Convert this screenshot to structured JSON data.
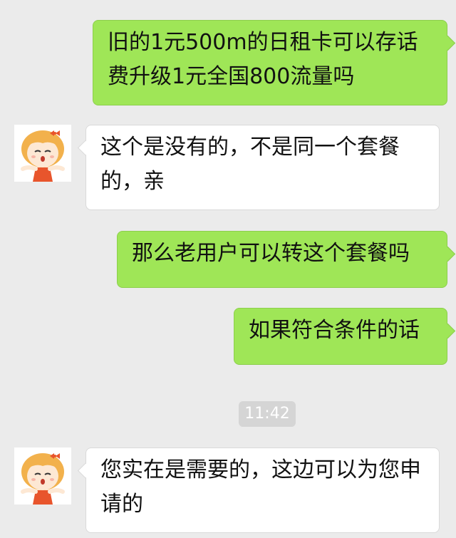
{
  "messages": [
    {
      "side": "sent",
      "text": "旧的1元500m的日租卡可以存话费升级1元全国800流量吗"
    },
    {
      "side": "recv",
      "text": "这个是没有的，不是同一个套餐的，亲"
    },
    {
      "side": "sent",
      "text": "那么老用户可以转这个套餐吗"
    },
    {
      "side": "sent",
      "text": "如果符合条件的话"
    },
    {
      "side": "recv",
      "text": "您实在是需要的，这边可以为您申请的"
    }
  ],
  "timestamp": "11:42",
  "colors": {
    "background": "#ebebeb",
    "sent_bubble": "#9fe657",
    "recv_bubble": "#ffffff",
    "timestamp_bg": "#d5d5d5"
  },
  "avatar": {
    "icon": "cartoon-girl-avatar-icon"
  }
}
